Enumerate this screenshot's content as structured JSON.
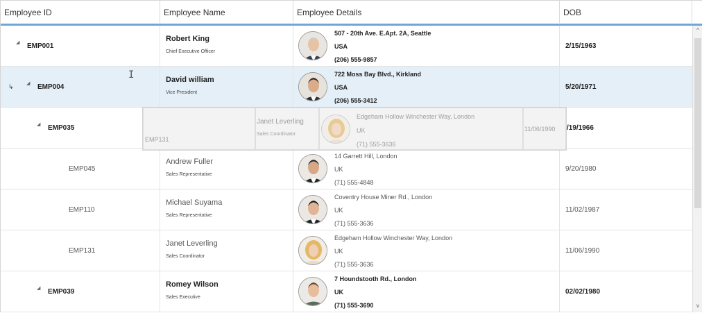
{
  "columns": [
    "Employee ID",
    "Employee Name",
    "Employee Details",
    "DOB"
  ],
  "rows": [
    {
      "id": "EMP001",
      "name": "Robert King",
      "title": "Chief Executive Officer",
      "address": "507 - 20th Ave. E.Apt. 2A, Seattle",
      "country": "USA",
      "phone": "(206) 555-9857",
      "dob": "2/15/1963"
    },
    {
      "id": "EMP004",
      "name": "David william",
      "title": "Vice President",
      "address": "722 Moss Bay Blvd., Kirkland",
      "country": "USA",
      "phone": "(206) 555-3412",
      "dob": "5/20/1971"
    },
    {
      "id": "EMP035",
      "dob": "/19/1966"
    },
    {
      "id": "EMP045",
      "name": "Andrew Fuller",
      "title": "Sales Representative",
      "address": "14 Garrett Hill, London",
      "country": "UK",
      "phone": "(71) 555-4848",
      "dob": "9/20/1980"
    },
    {
      "id": "EMP110",
      "name": "Michael Suyama",
      "title": "Sales Representative",
      "address": "Coventry House Miner Rd., London",
      "country": "UK",
      "phone": "(71) 555-3636",
      "dob": "11/02/1987"
    },
    {
      "id": "EMP131",
      "name": "Janet Leverling",
      "title": "Sales Coordinator",
      "address": "Edgeham Hollow Winchester Way, London",
      "country": "UK",
      "phone": "(71) 555-3636",
      "dob": "11/06/1990"
    },
    {
      "id": "EMP039",
      "name": "Romey Wilson",
      "title": "Sales Executive",
      "address": "7 Houndstooth Rd., London",
      "country": "UK",
      "phone": "(71) 555-3690",
      "dob": "02/02/1980"
    }
  ],
  "drag": {
    "id": "EMP131",
    "name": "Janet Leverling",
    "title": "Sales Coordinator",
    "address": "Edgeham Hollow Winchester Way, London",
    "country": "UK",
    "phone": "(71) 555-3636",
    "dob": "11/06/1990"
  },
  "icons": {
    "expander": "expand-triangle-icon",
    "drag": "drag-drop-arrow-icon",
    "cursor": "text-cursor-icon"
  },
  "colors": {
    "header_accent": "#6ea6d8",
    "selected_row": "#e4eff7"
  }
}
